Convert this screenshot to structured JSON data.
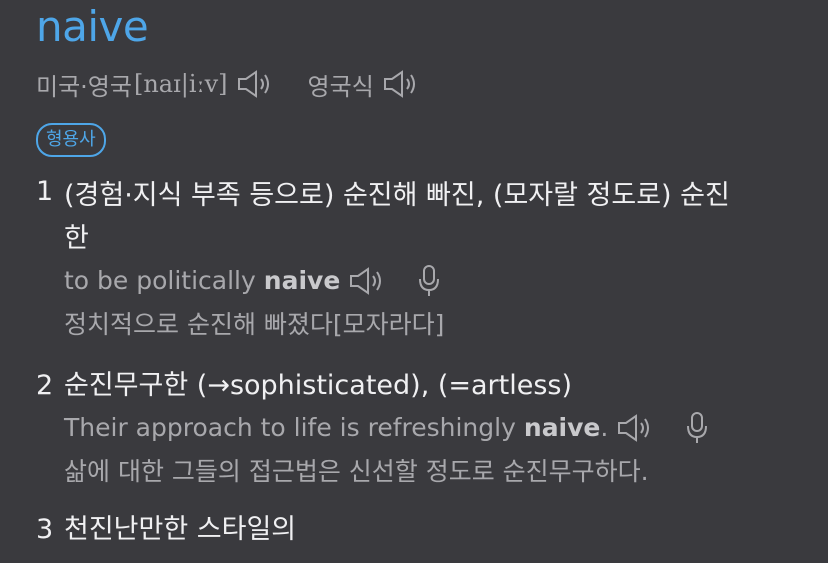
{
  "entry": {
    "headword": "naive",
    "pron_label_us_uk": "미국·영국",
    "ipa": "[naɪ|iːv]",
    "pron_label_uk": "영국식",
    "pos": "형용사"
  },
  "senses": [
    {
      "number": "1",
      "definition_line1": "(경험·지식 부족 등으로) 순진해 빠진, (모자랄 정도로) 순진",
      "definition_line2": "한",
      "example_pre": "to be politically",
      "example_bold": "naive",
      "example_post": "",
      "translation": "정치적으로 순진해 빠졌다[모자라다]"
    },
    {
      "number": "2",
      "definition_line1": "순진무구한 (→sophisticated), (=artless)",
      "example_pre": "Their approach to life is refreshingly",
      "example_bold": "naive",
      "example_post": ".",
      "translation": "삶에 대한 그들의 접근법은 신선할 정도로 순진무구하다."
    },
    {
      "number": "3",
      "definition_line1": "천진난만한 스타일의"
    }
  ],
  "icons": {
    "speaker": "speaker-icon",
    "mic": "microphone-icon"
  },
  "colors": {
    "background": "#3a3a3e",
    "accent": "#4ea6e8",
    "text": "#f0f0f2",
    "muted": "#a8a8ac"
  }
}
